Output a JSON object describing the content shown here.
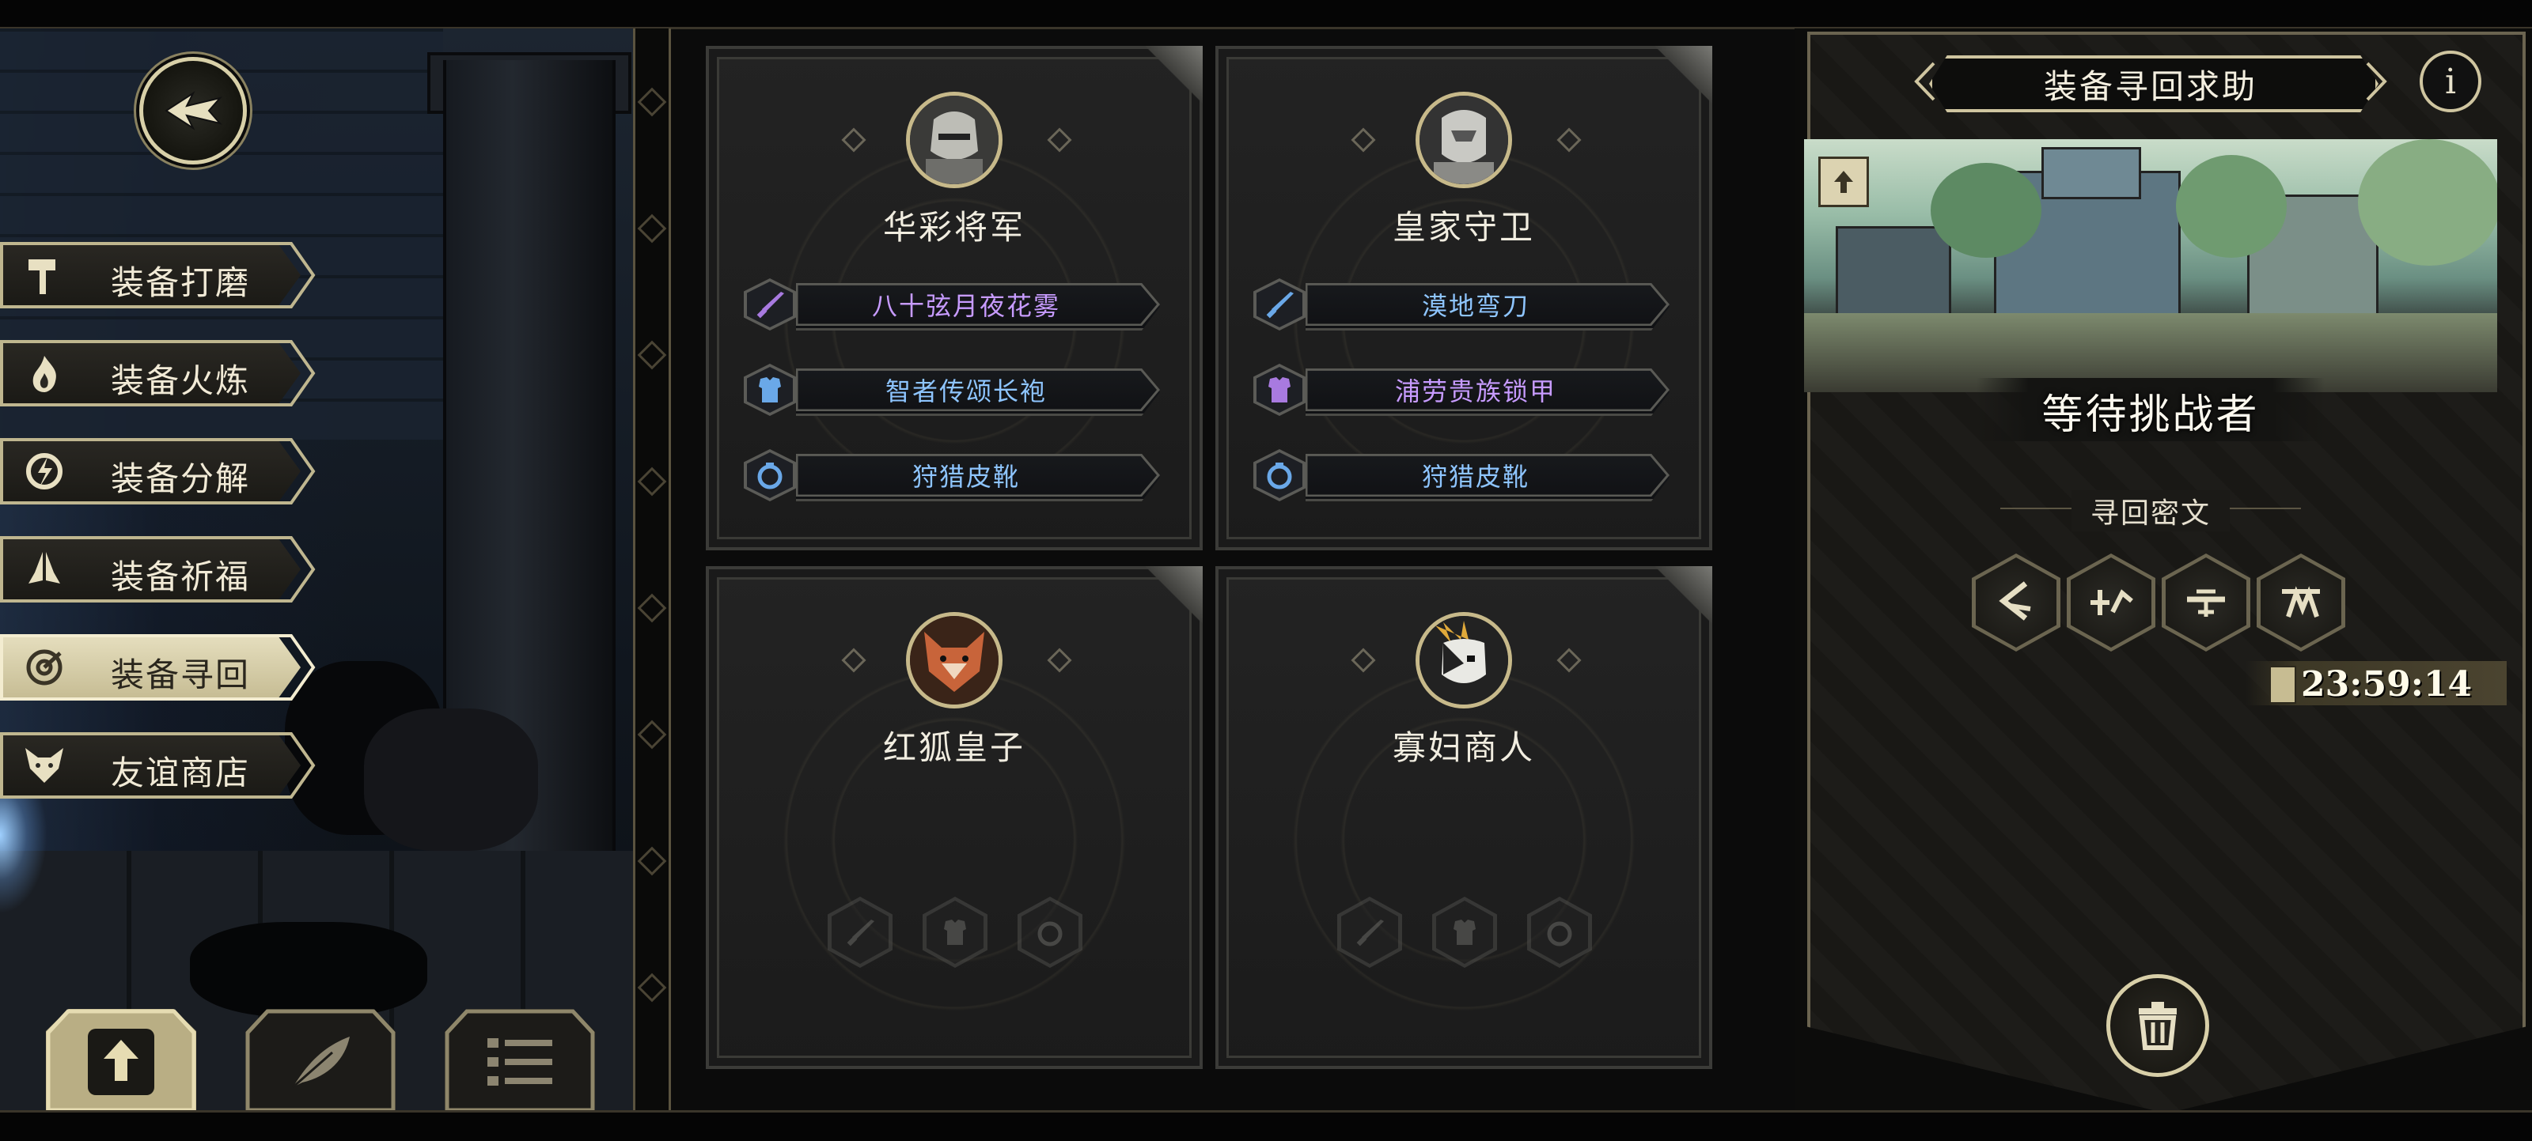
{
  "window": {
    "back_icon": "back-arrow-icon"
  },
  "side_menu": {
    "items": [
      {
        "label": "装备打磨",
        "icon": "hammer-icon",
        "active": false
      },
      {
        "label": "装备火炼",
        "icon": "flame-icon",
        "active": false
      },
      {
        "label": "装备分解",
        "icon": "dismantle-icon",
        "active": false
      },
      {
        "label": "装备祈福",
        "icon": "pray-hands-icon",
        "active": false
      },
      {
        "label": "装备寻回",
        "icon": "retrieve-target-icon",
        "active": true
      },
      {
        "label": "友谊商店",
        "icon": "fox-icon",
        "active": false
      }
    ]
  },
  "bottom_buttons": [
    {
      "icon": "upload-icon",
      "active": true
    },
    {
      "icon": "feather-icon",
      "active": false
    },
    {
      "icon": "list-icon",
      "active": false
    }
  ],
  "cards": [
    {
      "name": "华彩将军",
      "avatar_icon": "armored-general-avatar",
      "items": [
        {
          "icon": "sword-icon",
          "label": "八十弦月夜花雾",
          "color": "#c79bff"
        },
        {
          "icon": "armor-icon",
          "label": "智者传颂长袍",
          "color": "#8ec5ff"
        },
        {
          "icon": "ring-icon",
          "label": "狩猎皮靴",
          "color": "#8ec5ff"
        }
      ]
    },
    {
      "name": "皇家守卫",
      "avatar_icon": "royal-guard-avatar",
      "items": [
        {
          "icon": "sword-icon",
          "label": "漠地弯刀",
          "color": "#8ec5ff"
        },
        {
          "icon": "armor-icon",
          "label": "浦劳贵族锁甲",
          "color": "#c79bff"
        },
        {
          "icon": "ring-icon",
          "label": "狩猎皮靴",
          "color": "#8ec5ff"
        }
      ]
    },
    {
      "name": "红狐皇子",
      "avatar_icon": "red-fox-prince-avatar",
      "items": []
    },
    {
      "name": "寡妇商人",
      "avatar_icon": "widow-merchant-avatar",
      "items": []
    }
  ],
  "right_panel": {
    "title": "装备寻回求助",
    "info_label": "i",
    "status": "等待挑战者",
    "rune_title": "寻回密文",
    "runes": [
      "rune-1-icon",
      "rune-2-icon",
      "rune-3-icon",
      "rune-4-icon"
    ],
    "timer": "23:59:14",
    "delete_icon": "trash-icon"
  },
  "colors": {
    "gold": "#d8cfa8",
    "epic": "#c79bff",
    "rare": "#8ec5ff"
  }
}
